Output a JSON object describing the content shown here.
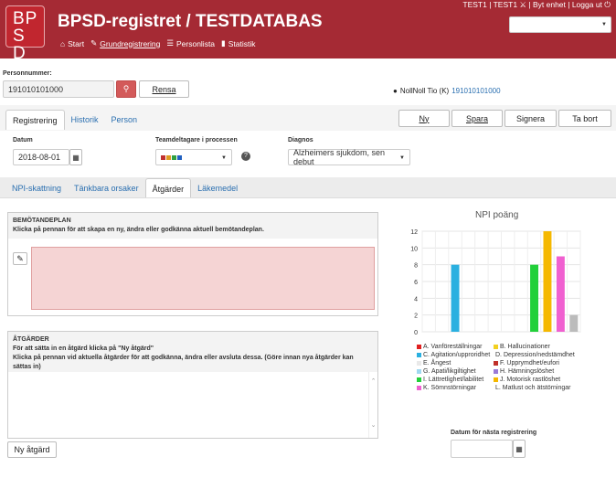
{
  "header": {
    "logo": "BP SD",
    "title": "BPSD-registret / TESTDATABAS",
    "nav": [
      "Start",
      "Grundregistrering",
      "Personlista",
      "Statistik"
    ],
    "user_bar": "TEST1 | TEST1 ⚔ | Byt enhet | Logga ut ⏻",
    "select_value": ""
  },
  "person": {
    "label": "Personnummer:",
    "value": "191010101000",
    "search_icon": "search-icon",
    "clear_label": "Rensa",
    "patient_label": "NollNoll Tio (K)",
    "patient_number": "191010101000"
  },
  "tabs_main": [
    "Registrering",
    "Historik",
    "Person"
  ],
  "actions": {
    "new": "Ny",
    "save": "Spara",
    "sign": "Signera",
    "delete": "Ta bort"
  },
  "form": {
    "date_label": "Datum",
    "date_value": "2018-08-01",
    "team_label": "Teamdeltagare i processen",
    "help": "?",
    "diagnosis_label": "Diagnos",
    "diagnosis_value": "Alzheimers sjukdom, sen debut"
  },
  "tabs_sub": [
    "NPI-skattning",
    "Tänkbara orsaker",
    "Åtgärder",
    "Läkemedel"
  ],
  "plan": {
    "title": "BEMÖTANDEPLAN",
    "text": "Klicka på pennan för att skapa en ny, ändra eller godkänna aktuell bemötandeplan."
  },
  "measures": {
    "title": "ÅTGÄRDER",
    "line1": "För att sätta in en åtgärd klicka på \"Ny åtgärd\"",
    "line2": "Klicka på pennan vid aktuella åtgärder för att godkänna, ändra eller avsluta dessa. (Göre innan nya åtgärder kan sättas in)",
    "new_label": "Ny åtgärd"
  },
  "next_reg": {
    "label": "Datum för nästa registrering",
    "value": ""
  },
  "chart_data": {
    "type": "bar",
    "title": "NPI poäng",
    "ylim": [
      0,
      12
    ],
    "yticks": [
      0,
      2,
      4,
      6,
      8,
      10,
      12
    ],
    "grid": true,
    "legend": "bottom",
    "series": [
      {
        "name": "A. Vanföreställningar",
        "value": 0,
        "color": "#e02020"
      },
      {
        "name": "B. Hallucinationer",
        "value": 0,
        "color": "#f2d020"
      },
      {
        "name": "C. Agitation/upproridhet",
        "value": 8,
        "color": "#2ab0e0"
      },
      {
        "name": "D. Depression/nedstämdhet",
        "value": 0,
        "color": "#2a9a3a"
      },
      {
        "name": "E. Ångest",
        "value": 0,
        "color": "#e9e9e9"
      },
      {
        "name": "F. Upprymdhet/eufori",
        "value": 0,
        "color": "#c0302a"
      },
      {
        "name": "G. Apati/likgiltighet",
        "value": 0,
        "color": "#a0d8f0"
      },
      {
        "name": "H. Hämningslöshet",
        "value": 0,
        "color": "#9a7ad8"
      },
      {
        "name": "I. Lättretlighet/labilitet",
        "value": 8,
        "color": "#22d03a"
      },
      {
        "name": "J. Motorisk rastlöshet",
        "value": 12,
        "color": "#f5b800"
      },
      {
        "name": "K. Sömnstörningar",
        "value": 9,
        "color": "#f060d0"
      },
      {
        "name": "L. Matlust och ätstörningar",
        "value": 2,
        "color": "#bbbbbb"
      }
    ]
  }
}
